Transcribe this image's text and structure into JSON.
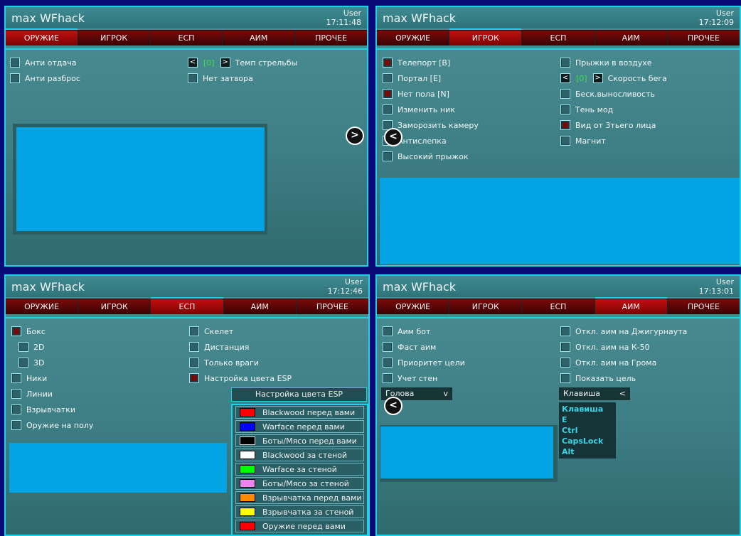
{
  "tabs": [
    "ОРУЖИЕ",
    "ИГРОК",
    "ЕСП",
    "АИМ",
    "ПРОЧЕЕ"
  ],
  "panels": [
    {
      "title": "max WFhack",
      "user": "User",
      "time": "17:11:48",
      "active_tab": 0,
      "left_options": [
        {
          "label": "Анти отдача",
          "checked": false
        },
        {
          "label": "Анти разброс",
          "checked": false
        }
      ],
      "stepper": {
        "value": "[0]",
        "label": "Темп стрельбы",
        "prev": "<",
        "next": ">"
      },
      "right_options": [
        {
          "label": "Нет затвора",
          "checked": false
        }
      ],
      "nav": ">"
    },
    {
      "title": "max WFhack",
      "user": "User",
      "time": "17:12:09",
      "active_tab": 1,
      "left_options": [
        {
          "label": "Телепорт [B]",
          "checked": true
        },
        {
          "label": "Портал [E]",
          "checked": false
        },
        {
          "label": "Нет пола [N]",
          "checked": true
        },
        {
          "label": "Изменить ник",
          "checked": false
        },
        {
          "label": "Заморозить камеру",
          "checked": false
        },
        {
          "label": "Антислепка",
          "checked": false
        },
        {
          "label": "Высокий прыжок",
          "checked": false
        }
      ],
      "right_top": {
        "label": "Прыжки в воздухе",
        "checked": false
      },
      "stepper": {
        "value": "[0]",
        "label": "Скорость бега",
        "prev": "<",
        "next": ">"
      },
      "right_options": [
        {
          "label": "Беск.выносливость",
          "checked": false
        },
        {
          "label": "Тень мод",
          "checked": false
        },
        {
          "label": "Вид от 3тьего лица",
          "checked": true
        },
        {
          "label": "Магнит",
          "checked": false
        }
      ],
      "nav": "<"
    },
    {
      "title": "max WFhack",
      "user": "User",
      "time": "17:12:46",
      "active_tab": 2,
      "left_options": [
        {
          "label": "Бокс",
          "checked": true,
          "indent": 0
        },
        {
          "label": "2D",
          "checked": false,
          "indent": 1
        },
        {
          "label": "3D",
          "checked": false,
          "indent": 1
        },
        {
          "label": "Ники",
          "checked": false,
          "indent": 0
        },
        {
          "label": "Линии",
          "checked": false,
          "indent": 0
        },
        {
          "label": "Взрывчатки",
          "checked": false,
          "indent": 0
        },
        {
          "label": "Оружие на полу",
          "checked": false,
          "indent": 0
        }
      ],
      "right_options": [
        {
          "label": "Скелет",
          "checked": false
        },
        {
          "label": "Дистанция",
          "checked": false
        },
        {
          "label": "Только враги",
          "checked": false
        },
        {
          "label": "Настройка цвета ESP",
          "checked": true
        }
      ],
      "esp_title": "Настройка цвета ESP",
      "esp_colors": [
        {
          "label": "Blackwood перед вами",
          "color": "#ff0000"
        },
        {
          "label": "Warface перед вами",
          "color": "#0000ff"
        },
        {
          "label": "Боты/Мясо перед вами",
          "color": "#000000"
        },
        {
          "label": "Blackwood за стеной",
          "color": "#ffffff"
        },
        {
          "label": "Warface за стеной",
          "color": "#00ff00"
        },
        {
          "label": "Боты/Мясо за стеной",
          "color": "#ee82ee"
        },
        {
          "label": "Взрывчатка перед вами",
          "color": "#ff8c00"
        },
        {
          "label": "Взрывчатка за стеной",
          "color": "#ffff00"
        },
        {
          "label": "Оружие перед вами",
          "color": "#ff0000"
        }
      ]
    },
    {
      "title": "max WFhack",
      "user": "User",
      "time": "17:13:01",
      "active_tab": 3,
      "left_options": [
        {
          "label": "Аим бот",
          "checked": false
        },
        {
          "label": "Фаст аим",
          "checked": false
        },
        {
          "label": "Приоритет цели",
          "checked": false
        },
        {
          "label": "Учет стен",
          "checked": false
        }
      ],
      "right_options": [
        {
          "label": "Откл. аим на Джигурнаута",
          "checked": false
        },
        {
          "label": "Откл. аим на К-50",
          "checked": false
        },
        {
          "label": "Откл. аим на Грома",
          "checked": false
        },
        {
          "label": "Показать цель",
          "checked": false
        }
      ],
      "bone_select": {
        "value": "Голова",
        "arrow": "v"
      },
      "key_select": {
        "value": "Клавиша",
        "arrow": "<",
        "options": [
          "Клавиша",
          "E",
          "Ctrl",
          "CapsLock",
          "Alt"
        ]
      },
      "nav": "<"
    }
  ]
}
